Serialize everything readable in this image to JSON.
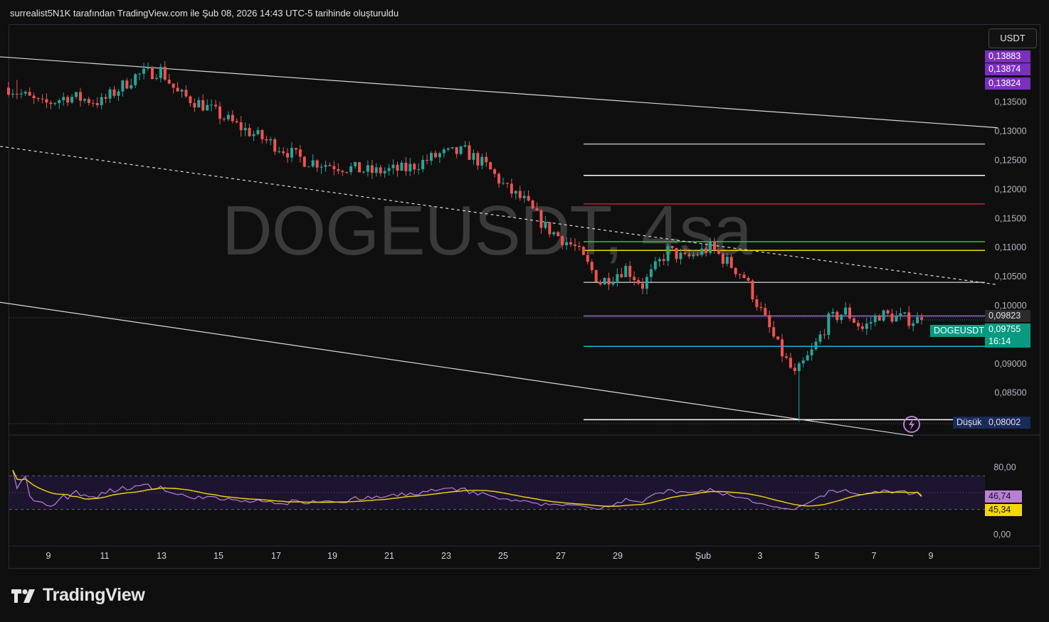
{
  "header": {
    "attribution": "surrealist5N1K tarafından TradingView.com ile Şub 08, 2026 14:43 UTC-5 tarihinde oluşturuldu"
  },
  "brand": {
    "name": "TradingView"
  },
  "watermark": "DOGEUSDT, 4sa",
  "currency_button": "USDT",
  "price_tags": {
    "top1": "0,13883",
    "top2": "0,13874",
    "top3": "0,13824",
    "line_value": "0,09823",
    "symbol": "DOGEUSDT",
    "last_price": "0,09755",
    "countdown": "16:14",
    "low_label": "Düşük",
    "low_value": "0,08002",
    "rsi_value": "46,74",
    "rsi_ma_value": "45,34"
  },
  "colors": {
    "background": "#0f0f0f",
    "up": "#26a69a",
    "down": "#ef5350",
    "rsi_line": "#b97fd6",
    "rsi_ma": "#f5d800",
    "last_price_tag": "#089981",
    "purple_tag": "#7b2fbf",
    "low_tag": "#1a2a5a"
  },
  "chart_data": [
    {
      "type": "candlestick",
      "title": "DOGEUSDT, 4sa",
      "ylabel": "USDT",
      "ylim": [
        0.0785,
        0.1413
      ],
      "y_ticks": [
        "0,13500",
        "0,13000",
        "0,12500",
        "0,12000",
        "0,11500",
        "0,11000",
        "0,10500",
        "0,10000",
        "0,09500",
        "0,09000",
        "0,08500"
      ],
      "x_ticks": [
        "9",
        "11",
        "13",
        "15",
        "17",
        "19",
        "21",
        "23",
        "25",
        "27",
        "29",
        "Şub",
        "3",
        "5",
        "7",
        "9"
      ],
      "close_path": [
        [
          0,
          0.1375
        ],
        [
          8,
          0.1345
        ],
        [
          14,
          0.136
        ],
        [
          22,
          0.135
        ],
        [
          30,
          0.1395
        ],
        [
          36,
          0.1405
        ],
        [
          40,
          0.1365
        ],
        [
          46,
          0.1345
        ],
        [
          54,
          0.131
        ],
        [
          62,
          0.128
        ],
        [
          70,
          0.125
        ],
        [
          78,
          0.124
        ],
        [
          86,
          0.123
        ],
        [
          94,
          0.1235
        ],
        [
          102,
          0.126
        ],
        [
          108,
          0.1265
        ],
        [
          113,
          0.124
        ],
        [
          118,
          0.12
        ],
        [
          122,
          0.118
        ],
        [
          127,
          0.1135
        ],
        [
          134,
          0.11
        ],
        [
          140,
          0.104
        ],
        [
          146,
          0.1065
        ],
        [
          150,
          0.1035
        ],
        [
          156,
          0.1095
        ],
        [
          160,
          0.108
        ],
        [
          166,
          0.11
        ],
        [
          170,
          0.1075
        ],
        [
          174,
          0.105
        ],
        [
          178,
          0.099
        ],
        [
          182,
          0.093
        ],
        [
          186,
          0.088
        ],
        [
          190,
          0.092
        ],
        [
          194,
          0.0975
        ],
        [
          198,
          0.099
        ],
        [
          202,
          0.096
        ],
        [
          206,
          0.0985
        ],
        [
          210,
          0.098
        ],
        [
          214,
          0.0975
        ],
        [
          216,
          0.09755
        ]
      ],
      "high": 0.13883,
      "low": 0.08002,
      "last": 0.09755,
      "horizontal_levels": [
        {
          "value": 0.1278,
          "color": "#b2b5be"
        },
        {
          "value": 0.1224,
          "color": "#ffffff"
        },
        {
          "value": 0.1175,
          "color": "#b22833"
        },
        {
          "value": 0.111,
          "color": "#4caf50"
        },
        {
          "value": 0.1095,
          "color": "#f5d800"
        },
        {
          "value": 0.104,
          "color": "#b2b5be"
        },
        {
          "value": 0.09823,
          "color": "#9c6ade"
        },
        {
          "value": 0.093,
          "color": "#00bcd4"
        },
        {
          "value": 0.0804,
          "color": "#ffffff"
        }
      ],
      "trendlines": [
        {
          "style": "solid",
          "from": [
            -6,
            0.143
          ],
          "to": [
            234,
            0.1306
          ]
        },
        {
          "style": "dashed",
          "from": [
            -6,
            0.1278
          ],
          "to": [
            234,
            0.1036
          ]
        },
        {
          "style": "solid",
          "from": [
            -6,
            0.101
          ],
          "to": [
            214,
            0.0776
          ]
        }
      ]
    },
    {
      "type": "line",
      "title": "RSI",
      "ylim": [
        0,
        100
      ],
      "y_ticks": [
        "80,00",
        "0,00"
      ],
      "band": [
        30,
        70
      ],
      "series": [
        {
          "role": "rsi",
          "last": 46.74
        },
        {
          "role": "rsi_ma",
          "last": 45.34
        }
      ]
    }
  ]
}
